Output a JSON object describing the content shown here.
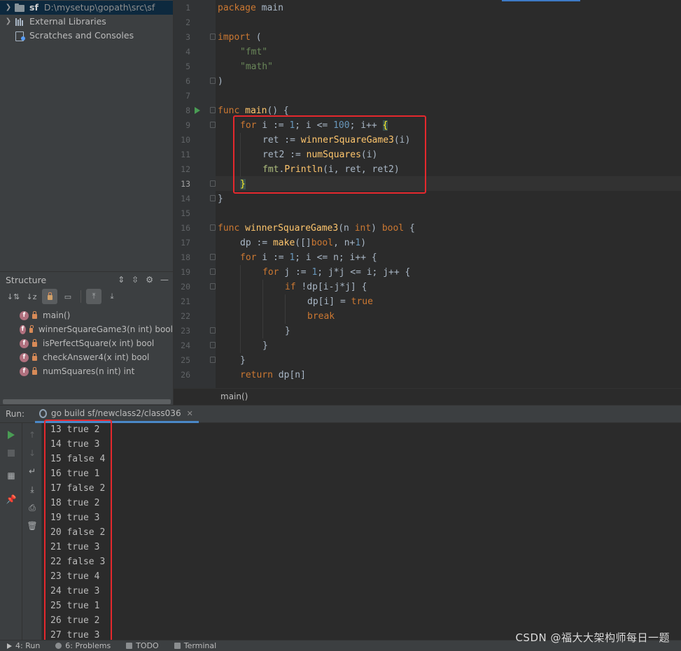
{
  "project_tree": {
    "items": [
      {
        "name": "sf",
        "path": "D:\\mysetup\\gopath\\src\\sf"
      },
      {
        "name": "External Libraries"
      },
      {
        "name": "Scratches and Consoles"
      }
    ]
  },
  "structure": {
    "title": "Structure",
    "items": [
      {
        "label": "main()"
      },
      {
        "label": "winnerSquareGame3(n int) bool"
      },
      {
        "label": "isPerfectSquare(x int) bool"
      },
      {
        "label": "checkAnswer4(x int) bool"
      },
      {
        "label": "numSquares(n int) int"
      }
    ],
    "badge": "f"
  },
  "editor": {
    "line_numbers": [
      "1",
      "2",
      "3",
      "4",
      "5",
      "6",
      "7",
      "8",
      "9",
      "10",
      "11",
      "12",
      "13",
      "14",
      "15",
      "16",
      "17",
      "18",
      "19",
      "20",
      "21",
      "22",
      "23",
      "24",
      "25",
      "26"
    ],
    "breadcrumb": "main()",
    "code": {
      "l1_kw": "package",
      "l1_rest": " main",
      "l3_kw": "import",
      "l3_rest": " (",
      "l4": "\"fmt\"",
      "l5": "\"math\"",
      "l6": ")",
      "l8_kw": "func",
      "l8_fn": "main",
      "l8_rest": "() {",
      "l9_kw": "for",
      "l9_a": " i := ",
      "l9_n1": "1",
      "l9_b": "; i <= ",
      "l9_n2": "100",
      "l9_c": "; i++ ",
      "l9_brace": "{",
      "l10_a": "ret := ",
      "l10_fn": "winnerSquareGame3",
      "l10_b": "(i)",
      "l11_a": "ret2 := ",
      "l11_fn": "numSquares",
      "l11_b": "(i)",
      "l12_pkg": "fmt",
      "l12_dot": ".",
      "l12_fn": "Println",
      "l12_b": "(i, ret, ret2)",
      "l13": "}",
      "l14": "}",
      "l16_kw": "func",
      "l16_fn": "winnerSquareGame3",
      "l16_a": "(n ",
      "l16_t1": "int",
      "l16_b": ") ",
      "l16_t2": "bool",
      "l16_c": " {",
      "l17_a": "dp := ",
      "l17_fn": "make",
      "l17_b": "([]",
      "l17_t": "bool",
      "l17_c": ", n+",
      "l17_n": "1",
      "l17_d": ")",
      "l18_kw": "for",
      "l18_a": " i := ",
      "l18_n": "1",
      "l18_b": "; i <= n; i++ {",
      "l19_kw": "for",
      "l19_a": " j := ",
      "l19_n": "1",
      "l19_b": "; j*j <= i; j++ {",
      "l20_kw": "if",
      "l20_a": " !dp[i-j*j] {",
      "l21_a": "dp[i] = ",
      "l21_kw": "true",
      "l22_kw": "break",
      "l23": "}",
      "l24": "}",
      "l25": "}",
      "l26_kw": "return",
      "l26_a": " dp[n]"
    }
  },
  "run": {
    "label": "Run:",
    "tab": "go build sf/newclass2/class036",
    "output": [
      "13 true 2",
      "14 true 3",
      "15 false 4",
      "16 true 1",
      "17 false 2",
      "18 true 2",
      "19 true 3",
      "20 false 2",
      "21 true 3",
      "22 false 3",
      "23 true 4",
      "24 true 3",
      "25 true 1",
      "26 true 2",
      "27 true 3"
    ]
  },
  "status_bar": {
    "tabs": [
      {
        "label": "4: Run"
      },
      {
        "label": "6: Problems"
      },
      {
        "label": "TODO"
      },
      {
        "label": "Terminal"
      }
    ]
  },
  "watermark": "CSDN @福大大架构师每日一题",
  "colors": {
    "highlight_box": "#e5282d",
    "keyword": "#cc7832",
    "function": "#ffc66d",
    "string": "#6a8759",
    "number": "#6897bb"
  }
}
